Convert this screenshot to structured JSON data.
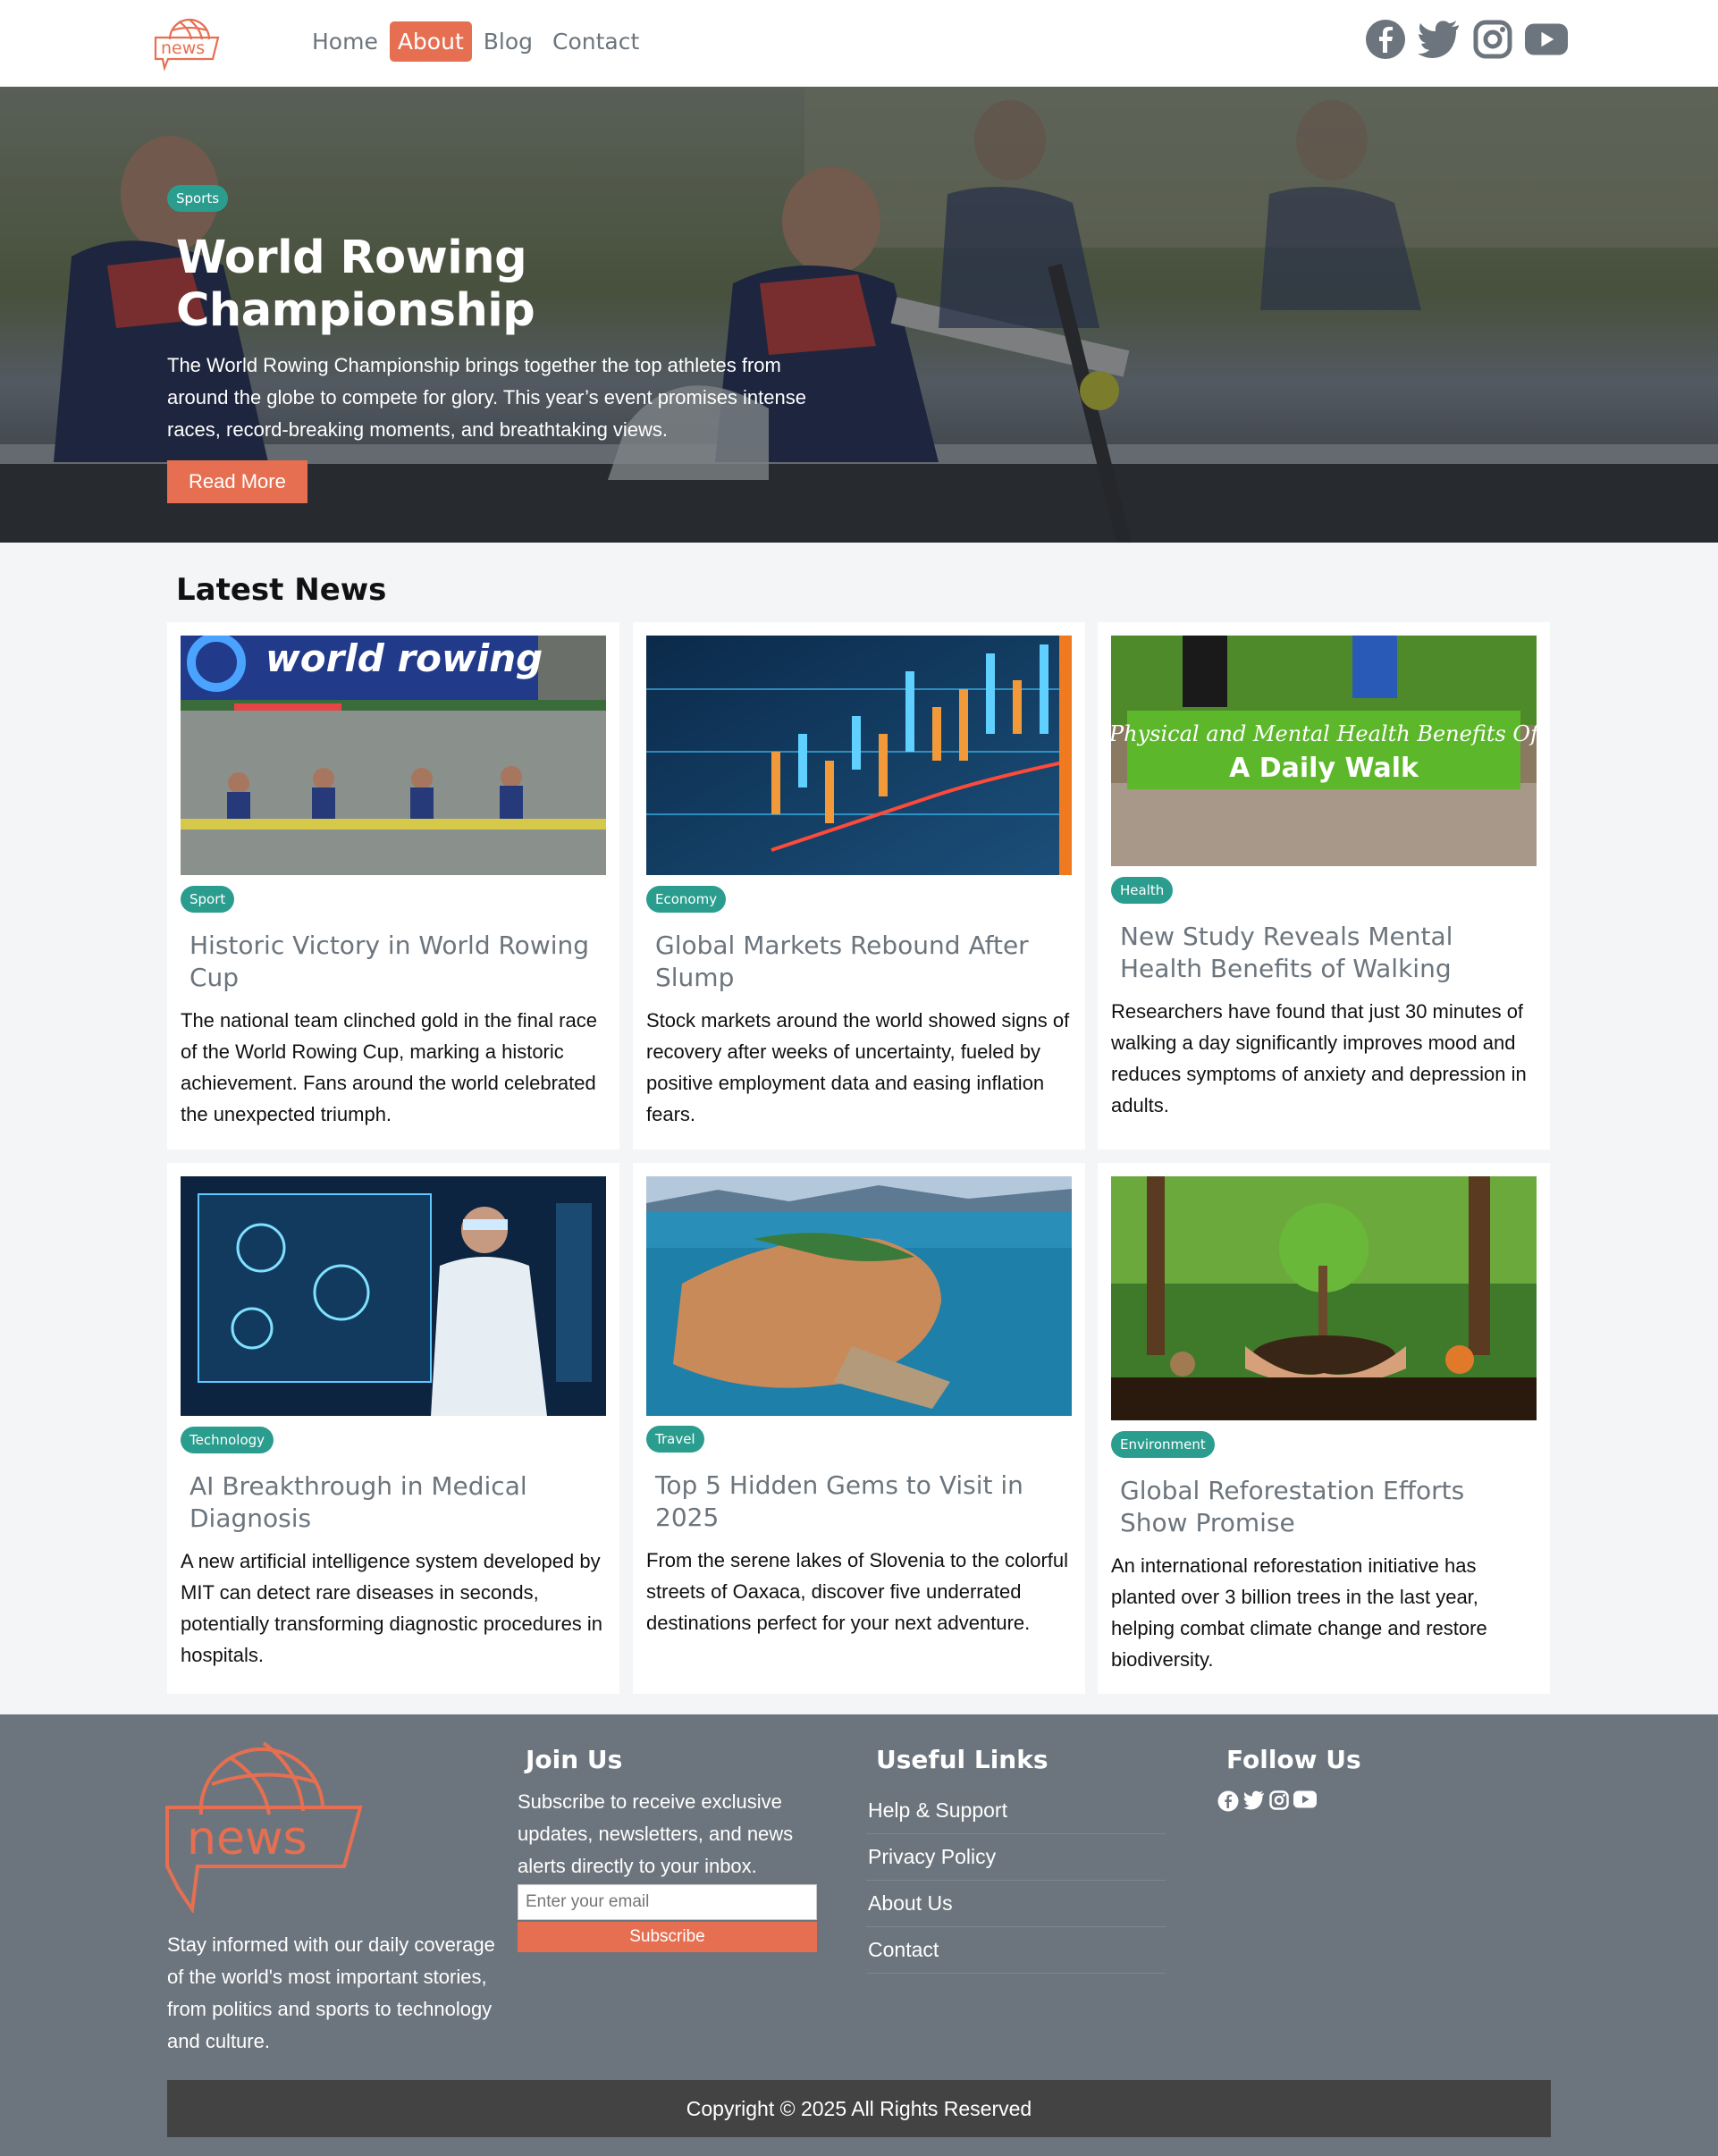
{
  "header": {
    "logo_text": "news",
    "nav": [
      {
        "label": "Home",
        "active": false
      },
      {
        "label": "About",
        "active": true
      },
      {
        "label": "Blog",
        "active": false
      },
      {
        "label": "Contact",
        "active": false
      }
    ],
    "social_icons": [
      "facebook-icon",
      "twitter-icon",
      "instagram-icon",
      "youtube-icon"
    ]
  },
  "hero": {
    "badge": "Sports",
    "title": "World Rowing Championship",
    "text": "The World Rowing Championship brings together the top athletes from around the globe to compete for glory. This year’s event promises intense races, record-breaking moments, and breathtaking views.",
    "button": "Read More"
  },
  "latest": {
    "title": "Latest News",
    "cards": [
      {
        "category": "Sport",
        "title": "Historic Victory in World Rowing Cup",
        "text": "The national team clinched gold in the final race of the World Rowing Cup, marking a historic achievement. Fans around the world celebrated the unexpected triumph.",
        "image_label": "world rowing"
      },
      {
        "category": "Economy",
        "title": "Global Markets Rebound After Slump",
        "text": "Stock markets around the world showed signs of recovery after weeks of uncertainty, fueled by positive employment data and easing inflation fears.",
        "image_label": ""
      },
      {
        "category": "Health",
        "title": "New Study Reveals Mental Health Benefits of Walking",
        "text": "Researchers have found that just 30 minutes of walking a day significantly improves mood and reduces symptoms of anxiety and depression in adults.",
        "image_label": "Physical and Mental Health Benefits Of",
        "image_label2": "A Daily Walk"
      },
      {
        "category": "Technology",
        "title": "AI Breakthrough in Medical Diagnosis",
        "text": "A new artificial intelligence system developed by MIT can detect rare diseases in seconds, potentially transforming diagnostic procedures in hospitals.",
        "image_label": ""
      },
      {
        "category": "Travel",
        "title": "Top 5 Hidden Gems to Visit in 2025",
        "text": "From the serene lakes of Slovenia to the colorful streets of Oaxaca, discover five underrated destinations perfect for your next adventure.",
        "image_label": ""
      },
      {
        "category": "Environment",
        "title": "Global Reforestation Efforts Show Promise",
        "text": "An international reforestation initiative has planted over 3 billion trees in the last year, helping combat climate change and restore biodiversity.",
        "image_label": ""
      }
    ]
  },
  "footer": {
    "logo_text": "news",
    "about": "Stay informed with our daily coverage of the world's most important stories, from politics and sports to technology and culture.",
    "join_title": "Join Us",
    "join_text": "Subscribe to receive exclusive updates, newsletters, and news alerts directly to your inbox.",
    "email_placeholder": "Enter your email",
    "subscribe": "Subscribe",
    "links_title": "Useful Links",
    "links": [
      "Help & Support",
      "Privacy Policy",
      "About Us",
      "Contact"
    ],
    "follow_title": "Follow Us",
    "copyright": "Copyright © 2025 All Rights Reserved"
  },
  "colors": {
    "accent": "#e76f51",
    "badge": "#2a9d8f",
    "footer_bg": "#6c757d",
    "copy_bg": "#434343"
  }
}
